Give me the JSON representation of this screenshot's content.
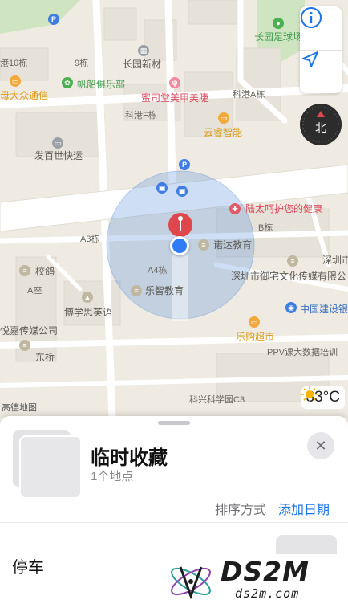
{
  "map": {
    "labels": {
      "changyuan_football": "长园足球场",
      "gangang10": "港10栋",
      "bldg9": "9栋",
      "changyuan_xincai": "长园新材",
      "gangang_a": "科港A栋",
      "dazhong": "母大众通信",
      "fanchuan": "帆船俱乐部",
      "mitang": "蜜司堂美甲美睫",
      "gangang_f": "科港F栋",
      "yunrui": "云睿智能",
      "fabaishi": "发百世快运",
      "lutai": "陆太呵护您的健康",
      "a3": "A3栋",
      "b": "B栋",
      "nuoda": "诺达教育",
      "shenzhen_right": "深圳市",
      "xiaoge": "校鸽",
      "a4": "A4栋",
      "yuzhai": "深圳市御宅文化传媒有限公",
      "azuo": "A座",
      "lezhi": "乐智教育",
      "boxue": "博学思英语",
      "ccb": "中国建设银",
      "yuejia": "悦嘉传媒公司",
      "dongqiao": "东桥",
      "legou": "乐购超市",
      "ppv": "PPV课大数据培训",
      "kexing_c3": "科兴科学园C3",
      "gaode": "高德地图"
    }
  },
  "controls": {
    "info_icon": "info-icon",
    "locate_icon": "location-arrow-icon",
    "compass_label": "北"
  },
  "weather": {
    "icon": "sun-icon",
    "temperature": "33°C"
  },
  "sheet": {
    "title": "临时收藏",
    "subtitle": "1个地点",
    "sort_label": "排序方式",
    "sort_value": "添加日期",
    "row_label": "停车"
  },
  "watermark": {
    "big": "DS2M",
    "small": "ds2m.com"
  },
  "colors": {
    "accent_blue": "#1a73e8",
    "pin_red": "#e0474c",
    "location_blue": "#2f7cf6"
  }
}
